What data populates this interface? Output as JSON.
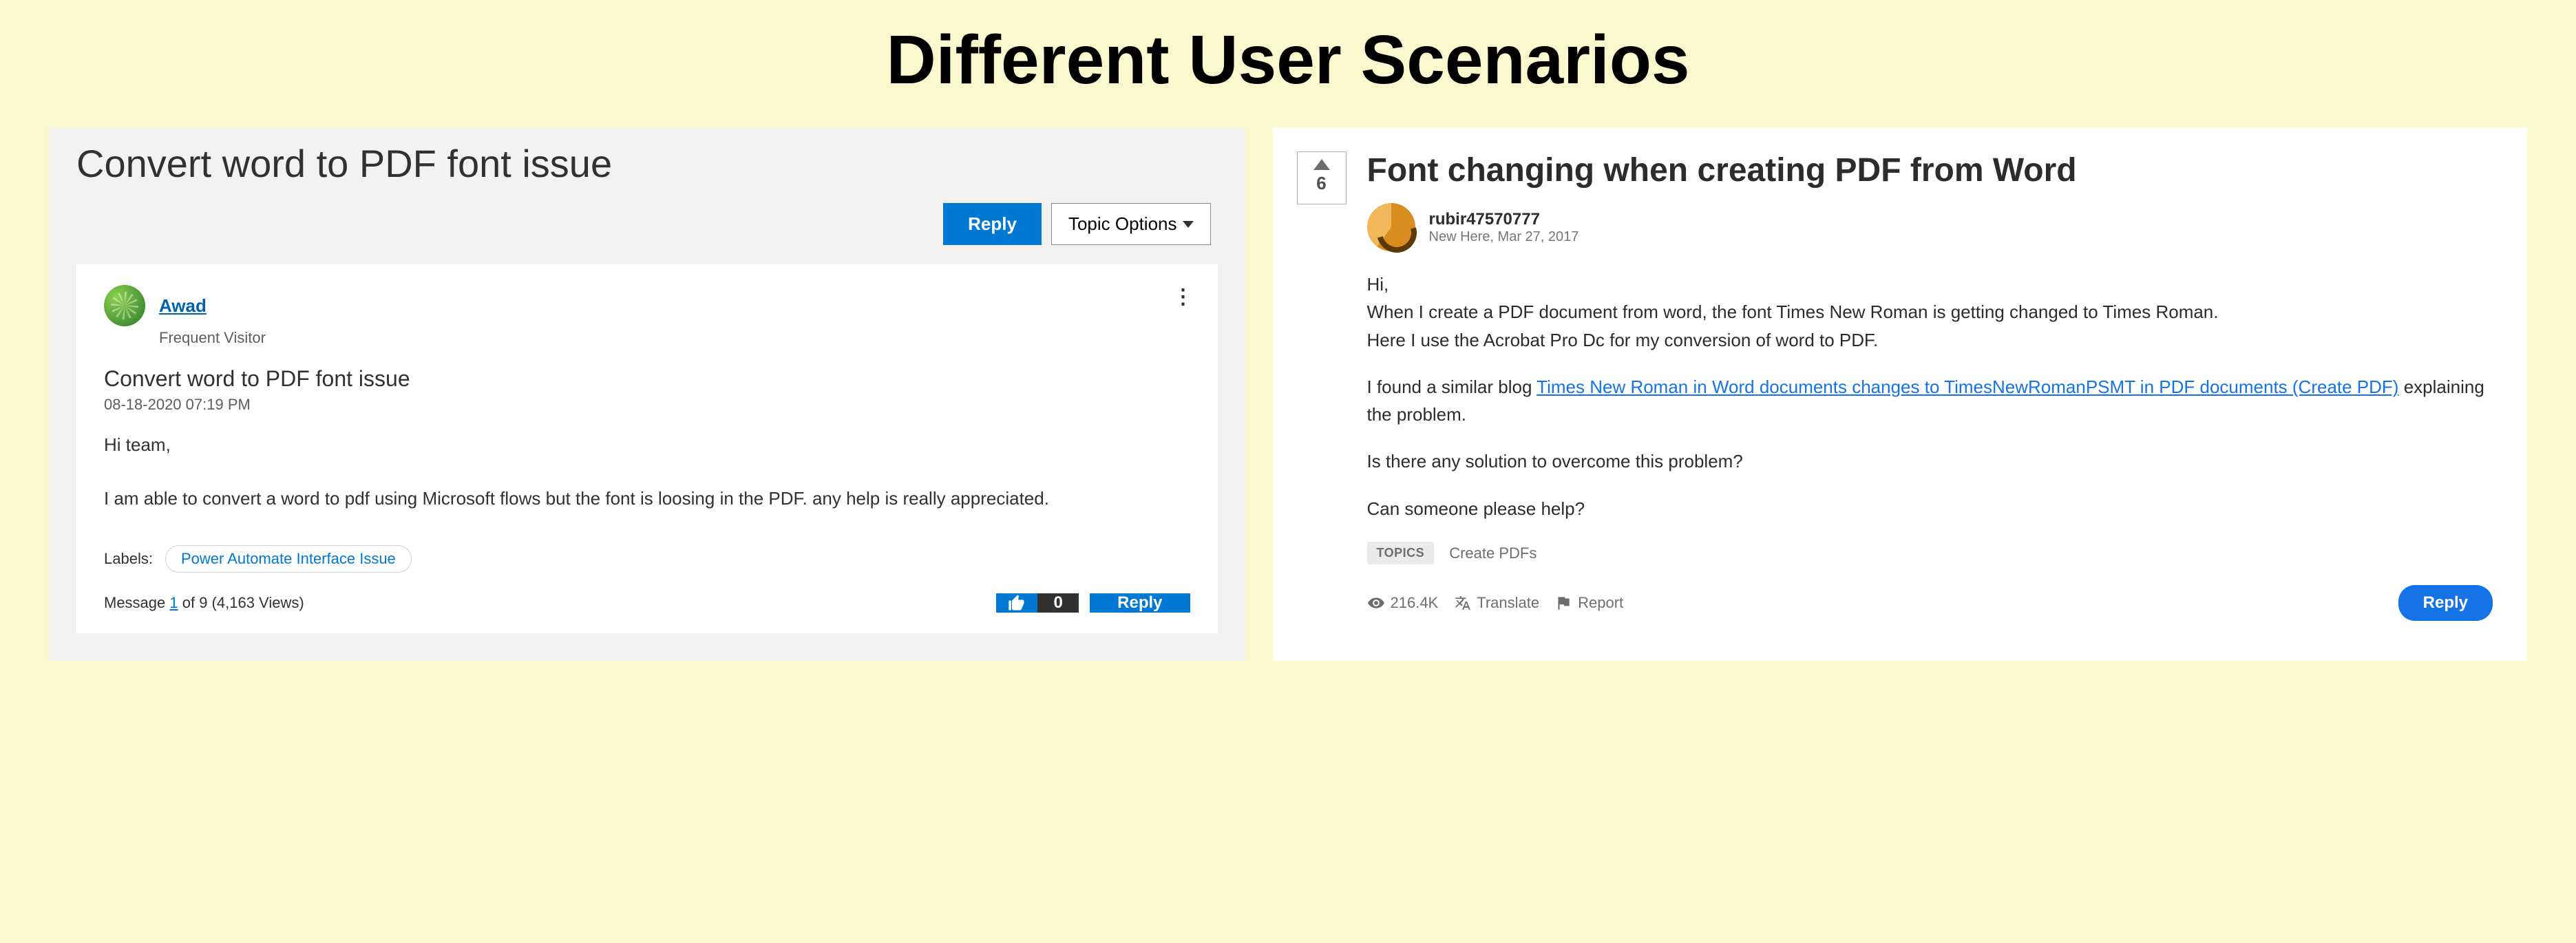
{
  "page": {
    "title": "Different User Scenarios"
  },
  "left": {
    "title": "Convert word to PDF font issue",
    "reply_btn": "Reply",
    "topic_options": "Topic Options",
    "post": {
      "author": "Awad",
      "role": "Frequent Visitor",
      "title": "Convert word to PDF font issue",
      "date": "08-18-2020 07:19 PM",
      "greeting": "Hi team,",
      "body": "I am able to convert a word to pdf using Microsoft flows but the font is loosing in the PDF. any help is really appreciated.",
      "labels_label": "Labels:",
      "label_value": "Power Automate Interface Issue",
      "message_prefix": "Message ",
      "message_num": "1",
      "message_suffix": " of 9  (4,163 Views)",
      "thumbs_count": "0",
      "reply_btn": "Reply"
    }
  },
  "right": {
    "vote_count": "6",
    "title": "Font changing when creating PDF from Word",
    "author": "rubir47570777",
    "author_meta": "New Here, Mar 27, 2017",
    "body": {
      "p1": "Hi,",
      "p2a": "When I create a PDF document from word, the font Times New Roman is getting changed to Times Roman.",
      "p2b": "Here I use the Acrobat Pro Dc for my conversion of word to PDF.",
      "p3_pre": "I found a similar blog ",
      "p3_link": "Times New Roman in Word documents changes to TimesNewRomanPSMT in PDF documents (Create PDF)",
      "p3_post": "  explaining the problem.",
      "p4": "Is there any solution to overcome this problem?",
      "p5": "Can someone please help?"
    },
    "topics_label": "TOPICS",
    "topics_value": "Create PDFs",
    "views": "216.4K",
    "translate": "Translate",
    "report": "Report",
    "reply_btn": "Reply"
  }
}
